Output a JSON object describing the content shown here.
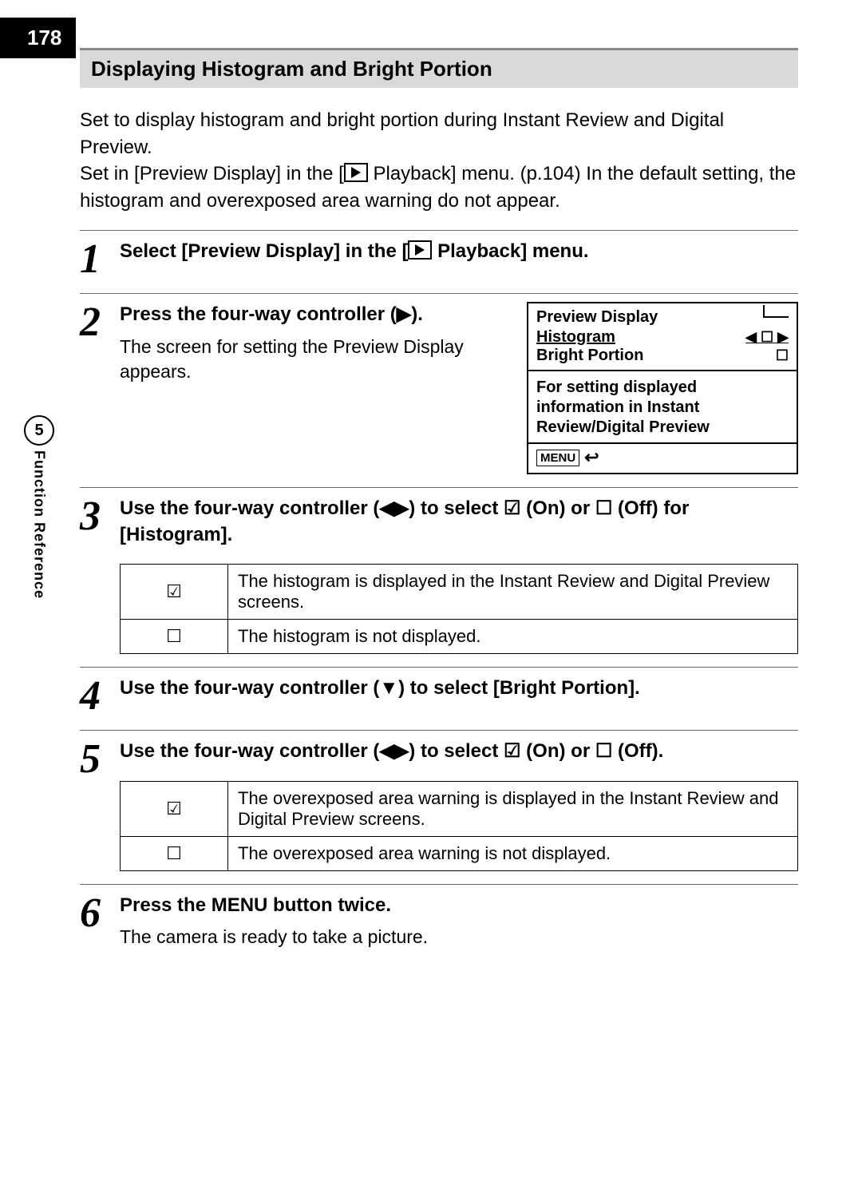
{
  "page_number": "178",
  "side_tab": {
    "chapter_number": "5",
    "chapter_label": "Function Reference"
  },
  "section_title": "Displaying Histogram and Bright Portion",
  "intro_line1": "Set to display histogram and bright portion during Instant Review and Digital Preview.",
  "intro_line2_a": "Set in [Preview Display] in the [",
  "intro_line2_b": " Playback] menu. (p.104) In the default setting, the histogram and overexposed area warning do not appear.",
  "steps": {
    "s1": {
      "num": "1",
      "heading_a": "Select [Preview Display] in the [",
      "heading_b": " Playback] menu."
    },
    "s2": {
      "num": "2",
      "heading": "Press the four-way controller (▶).",
      "text": "The screen for setting the Preview Display appears."
    },
    "s3": {
      "num": "3",
      "heading": "Use the four-way controller (◀▶) to select ☑ (On) or ☐ (Off) for [Histogram].",
      "table": {
        "on_sym": "☑",
        "on_text": "The histogram is displayed in the Instant Review and Digital Preview screens.",
        "off_sym": "☐",
        "off_text": "The histogram is not displayed."
      }
    },
    "s4": {
      "num": "4",
      "heading": "Use the four-way controller (▼) to select [Bright Portion]."
    },
    "s5": {
      "num": "5",
      "heading": "Use the four-way controller (◀▶) to select ☑ (On) or ☐ (Off).",
      "table": {
        "on_sym": "☑",
        "on_text": "The overexposed area warning is displayed in the Instant Review and Digital Preview screens.",
        "off_sym": "☐",
        "off_text": "The overexposed area warning is not displayed."
      }
    },
    "s6": {
      "num": "6",
      "heading": "Press the MENU button twice.",
      "text": "The camera is ready to take a picture."
    }
  },
  "camera_screen": {
    "title": "Preview Display",
    "row1_label": "Histogram",
    "row1_value": "◀ ☐ ▶",
    "row2_label": "Bright Portion",
    "row2_value": "☐",
    "desc": "For setting displayed information in Instant Review/Digital Preview",
    "footer_menu": "MENU",
    "footer_arrow": "↩"
  }
}
